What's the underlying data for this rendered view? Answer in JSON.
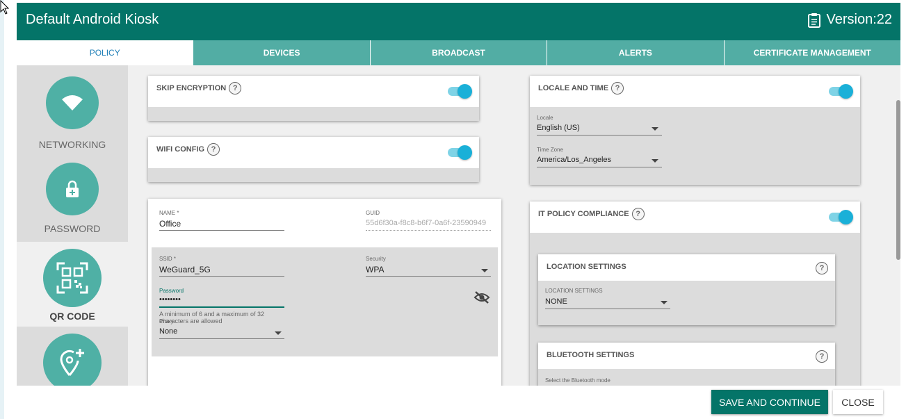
{
  "header": {
    "title": "Default Android Kiosk",
    "version": "Version:22"
  },
  "tabs": [
    {
      "label": "POLICY",
      "active": true
    },
    {
      "label": "DEVICES"
    },
    {
      "label": "BROADCAST"
    },
    {
      "label": "ALERTS"
    },
    {
      "label": "CERTIFICATE MANAGEMENT"
    }
  ],
  "sidebar": {
    "items": [
      {
        "label": "NETWORKING",
        "icon": "wifi-icon"
      },
      {
        "label": "PASSWORD",
        "icon": "lock-plus-icon"
      },
      {
        "label": "QR CODE",
        "icon": "qr-code-icon",
        "active": true
      },
      {
        "label": "",
        "icon": "location-plus-icon"
      }
    ]
  },
  "skip_encryption": {
    "title": "SKIP ENCRYPTION",
    "help": "?",
    "enabled": true
  },
  "wifi_config": {
    "title": "WIFI CONFIG",
    "help": "?",
    "enabled": true,
    "name_label": "NAME *",
    "name_value": "Office",
    "guid_label": "GUID",
    "guid_value": "55d6f30a-f8c8-b6f7-0a6f-23590949",
    "ssid_label": "SSID *",
    "ssid_value": "WeGuard_5G",
    "security_label": "Security",
    "security_value": "WPA",
    "password_label": "Password",
    "password_value": "••••••••",
    "password_hint": "A minimum of 6 and a maximum of 32 characters are allowed",
    "proxy_label": "Proxy",
    "proxy_value": "None"
  },
  "locale_time": {
    "title": "LOCALE AND TIME",
    "help": "?",
    "enabled": true,
    "locale_label": "Locale",
    "locale_value": "English (US)",
    "tz_label": "Time Zone",
    "tz_value": "America/Los_Angeles"
  },
  "it_policy": {
    "title": "IT POLICY COMPLIANCE",
    "help": "?",
    "enabled": true,
    "location": {
      "title": "LOCATION SETTINGS",
      "help": "?",
      "field_label": "LOCATION SETTINGS",
      "field_value": "NONE"
    },
    "bluetooth": {
      "title": "BLUETOOTH SETTINGS",
      "help": "?",
      "field_label": "Select the Bluetooth mode"
    }
  },
  "footer": {
    "save_label": "SAVE AND CONTINUE",
    "close_label": "CLOSE"
  },
  "colors": {
    "header": "#047468",
    "tab": "#52ada4",
    "accent": "#1ab0d8",
    "side_circle": "#4fb0a5"
  }
}
